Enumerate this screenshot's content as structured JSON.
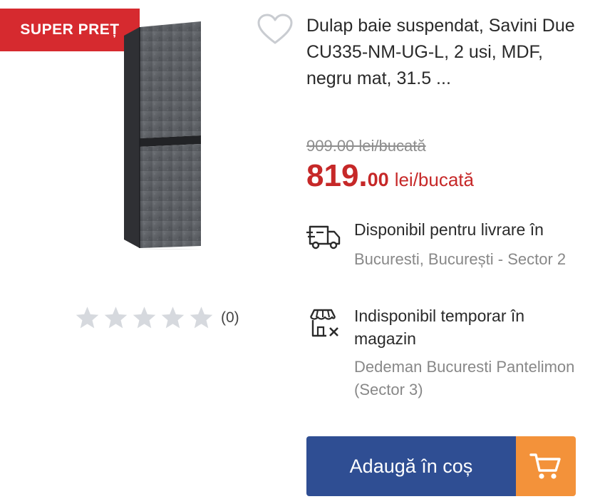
{
  "badge": {
    "label": "SUPER PREȚ"
  },
  "product": {
    "title": "Dulap baie suspendat, Savini Due CU335-NM-UG-L, 2 usi, MDF, negru mat, 31.5 ...",
    "image_icon": "bathroom-cabinet-image",
    "wishlist_icon": "heart-outline-icon"
  },
  "price": {
    "old": "909.00 lei/bucată",
    "integer": "819.",
    "decimal": "00",
    "unit": "lei/bucată"
  },
  "delivery": {
    "icon": "delivery-truck-icon",
    "label": "Disponibil pentru livrare în",
    "location": "Bucuresti, București - Sector 2"
  },
  "store": {
    "icon": "store-unavailable-icon",
    "label": "Indisponibil temporar în magazin",
    "location": "Dedeman Bucuresti Pantelimon (Sector 3)"
  },
  "rating": {
    "stars": 0,
    "max": 5,
    "count_label": "(0)"
  },
  "cart_button": {
    "label": "Adaugă în coș",
    "icon": "shopping-cart-icon"
  },
  "colors": {
    "badge": "#d62a2f",
    "price": "#c62828",
    "cart_button": "#2f4e93",
    "cart_icon_bg": "#f3923a",
    "muted_text": "#888888",
    "star": "#d6d9de"
  }
}
